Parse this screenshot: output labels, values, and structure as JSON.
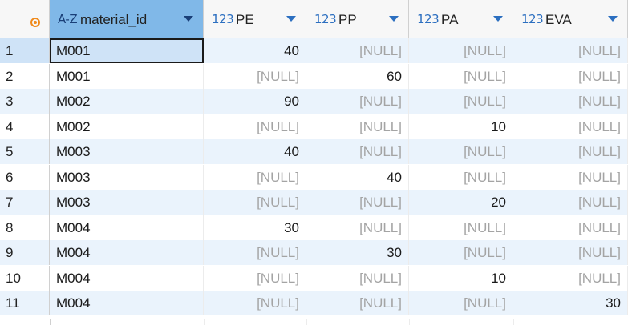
{
  "columns": [
    {
      "type": "A-Z",
      "name": "material_id",
      "selected": true
    },
    {
      "type": "123",
      "name": "PE"
    },
    {
      "type": "123",
      "name": "PP"
    },
    {
      "type": "123",
      "name": "PA"
    },
    {
      "type": "123",
      "name": "EVA"
    }
  ],
  "null_text": "[NULL]",
  "rows": [
    {
      "n": "1",
      "material_id": "M001",
      "PE": "40",
      "PP": "[NULL]",
      "PA": "[NULL]",
      "EVA": "[NULL]"
    },
    {
      "n": "2",
      "material_id": "M001",
      "PE": "[NULL]",
      "PP": "60",
      "PA": "[NULL]",
      "EVA": "[NULL]"
    },
    {
      "n": "3",
      "material_id": "M002",
      "PE": "90",
      "PP": "[NULL]",
      "PA": "[NULL]",
      "EVA": "[NULL]"
    },
    {
      "n": "4",
      "material_id": "M002",
      "PE": "[NULL]",
      "PP": "[NULL]",
      "PA": "10",
      "EVA": "[NULL]"
    },
    {
      "n": "5",
      "material_id": "M003",
      "PE": "40",
      "PP": "[NULL]",
      "PA": "[NULL]",
      "EVA": "[NULL]"
    },
    {
      "n": "6",
      "material_id": "M003",
      "PE": "[NULL]",
      "PP": "40",
      "PA": "[NULL]",
      "EVA": "[NULL]"
    },
    {
      "n": "7",
      "material_id": "M003",
      "PE": "[NULL]",
      "PP": "[NULL]",
      "PA": "20",
      "EVA": "[NULL]"
    },
    {
      "n": "8",
      "material_id": "M004",
      "PE": "30",
      "PP": "[NULL]",
      "PA": "[NULL]",
      "EVA": "[NULL]"
    },
    {
      "n": "9",
      "material_id": "M004",
      "PE": "[NULL]",
      "PP": "30",
      "PA": "[NULL]",
      "EVA": "[NULL]"
    },
    {
      "n": "10",
      "material_id": "M004",
      "PE": "[NULL]",
      "PP": "[NULL]",
      "PA": "10",
      "EVA": "[NULL]"
    },
    {
      "n": "11",
      "material_id": "M004",
      "PE": "[NULL]",
      "PP": "[NULL]",
      "PA": "[NULL]",
      "EVA": "30"
    }
  ],
  "colors": {
    "header_selected": "#80b8e8",
    "row_alt": "#eaf3fc",
    "type_icon": "#2c6fc0",
    "null": "#a4a4a4",
    "corner_icon": "#f08a1c"
  }
}
